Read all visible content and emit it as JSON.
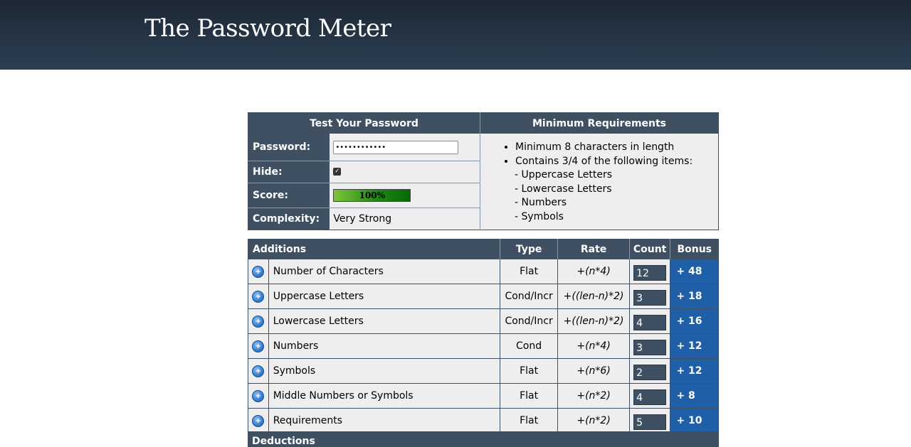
{
  "header": {
    "title": "The Password Meter"
  },
  "test_panel": {
    "heading": "Test Your Password",
    "password_label": "Password:",
    "password_value": "••••••••••••",
    "hide_label": "Hide:",
    "hide_checked": true,
    "score_label": "Score:",
    "score_text": "100%",
    "score_fraction": 1.0,
    "complexity_label": "Complexity:",
    "complexity_value": "Very Strong"
  },
  "requirements": {
    "heading": "Minimum Requirements",
    "item1": "Minimum 8 characters in length",
    "item2": "Contains 3/4 of the following items:",
    "sub": [
      "- Uppercase Letters",
      "- Lowercase Letters",
      "- Numbers",
      "- Symbols"
    ]
  },
  "additions": {
    "headers": {
      "name": "Additions",
      "type": "Type",
      "rate": "Rate",
      "count": "Count",
      "bonus": "Bonus"
    },
    "rows": [
      {
        "name": "Number of Characters",
        "type": "Flat",
        "rate": "+(n*4)",
        "count": "12",
        "bonus": "+ 48"
      },
      {
        "name": "Uppercase Letters",
        "type": "Cond/Incr",
        "rate": "+((len-n)*2)",
        "count": "3",
        "bonus": "+ 18"
      },
      {
        "name": "Lowercase Letters",
        "type": "Cond/Incr",
        "rate": "+((len-n)*2)",
        "count": "4",
        "bonus": "+ 16"
      },
      {
        "name": "Numbers",
        "type": "Cond",
        "rate": "+(n*4)",
        "count": "3",
        "bonus": "+ 12"
      },
      {
        "name": "Symbols",
        "type": "Flat",
        "rate": "+(n*6)",
        "count": "2",
        "bonus": "+ 12"
      },
      {
        "name": "Middle Numbers or Symbols",
        "type": "Flat",
        "rate": "+(n*2)",
        "count": "4",
        "bonus": "+ 8"
      },
      {
        "name": "Requirements",
        "type": "Flat",
        "rate": "+(n*2)",
        "count": "5",
        "bonus": "+ 10"
      }
    ]
  },
  "deductions": {
    "heading": "Deductions"
  },
  "icons": {
    "row_icon": "info-plus-icon",
    "check": "checkmark-icon"
  },
  "colors": {
    "header_bg": "#2c3f53",
    "panel_dark": "#3e5062",
    "bonus_blue": "#1f5fa8",
    "score_green": "#1f8a12"
  }
}
